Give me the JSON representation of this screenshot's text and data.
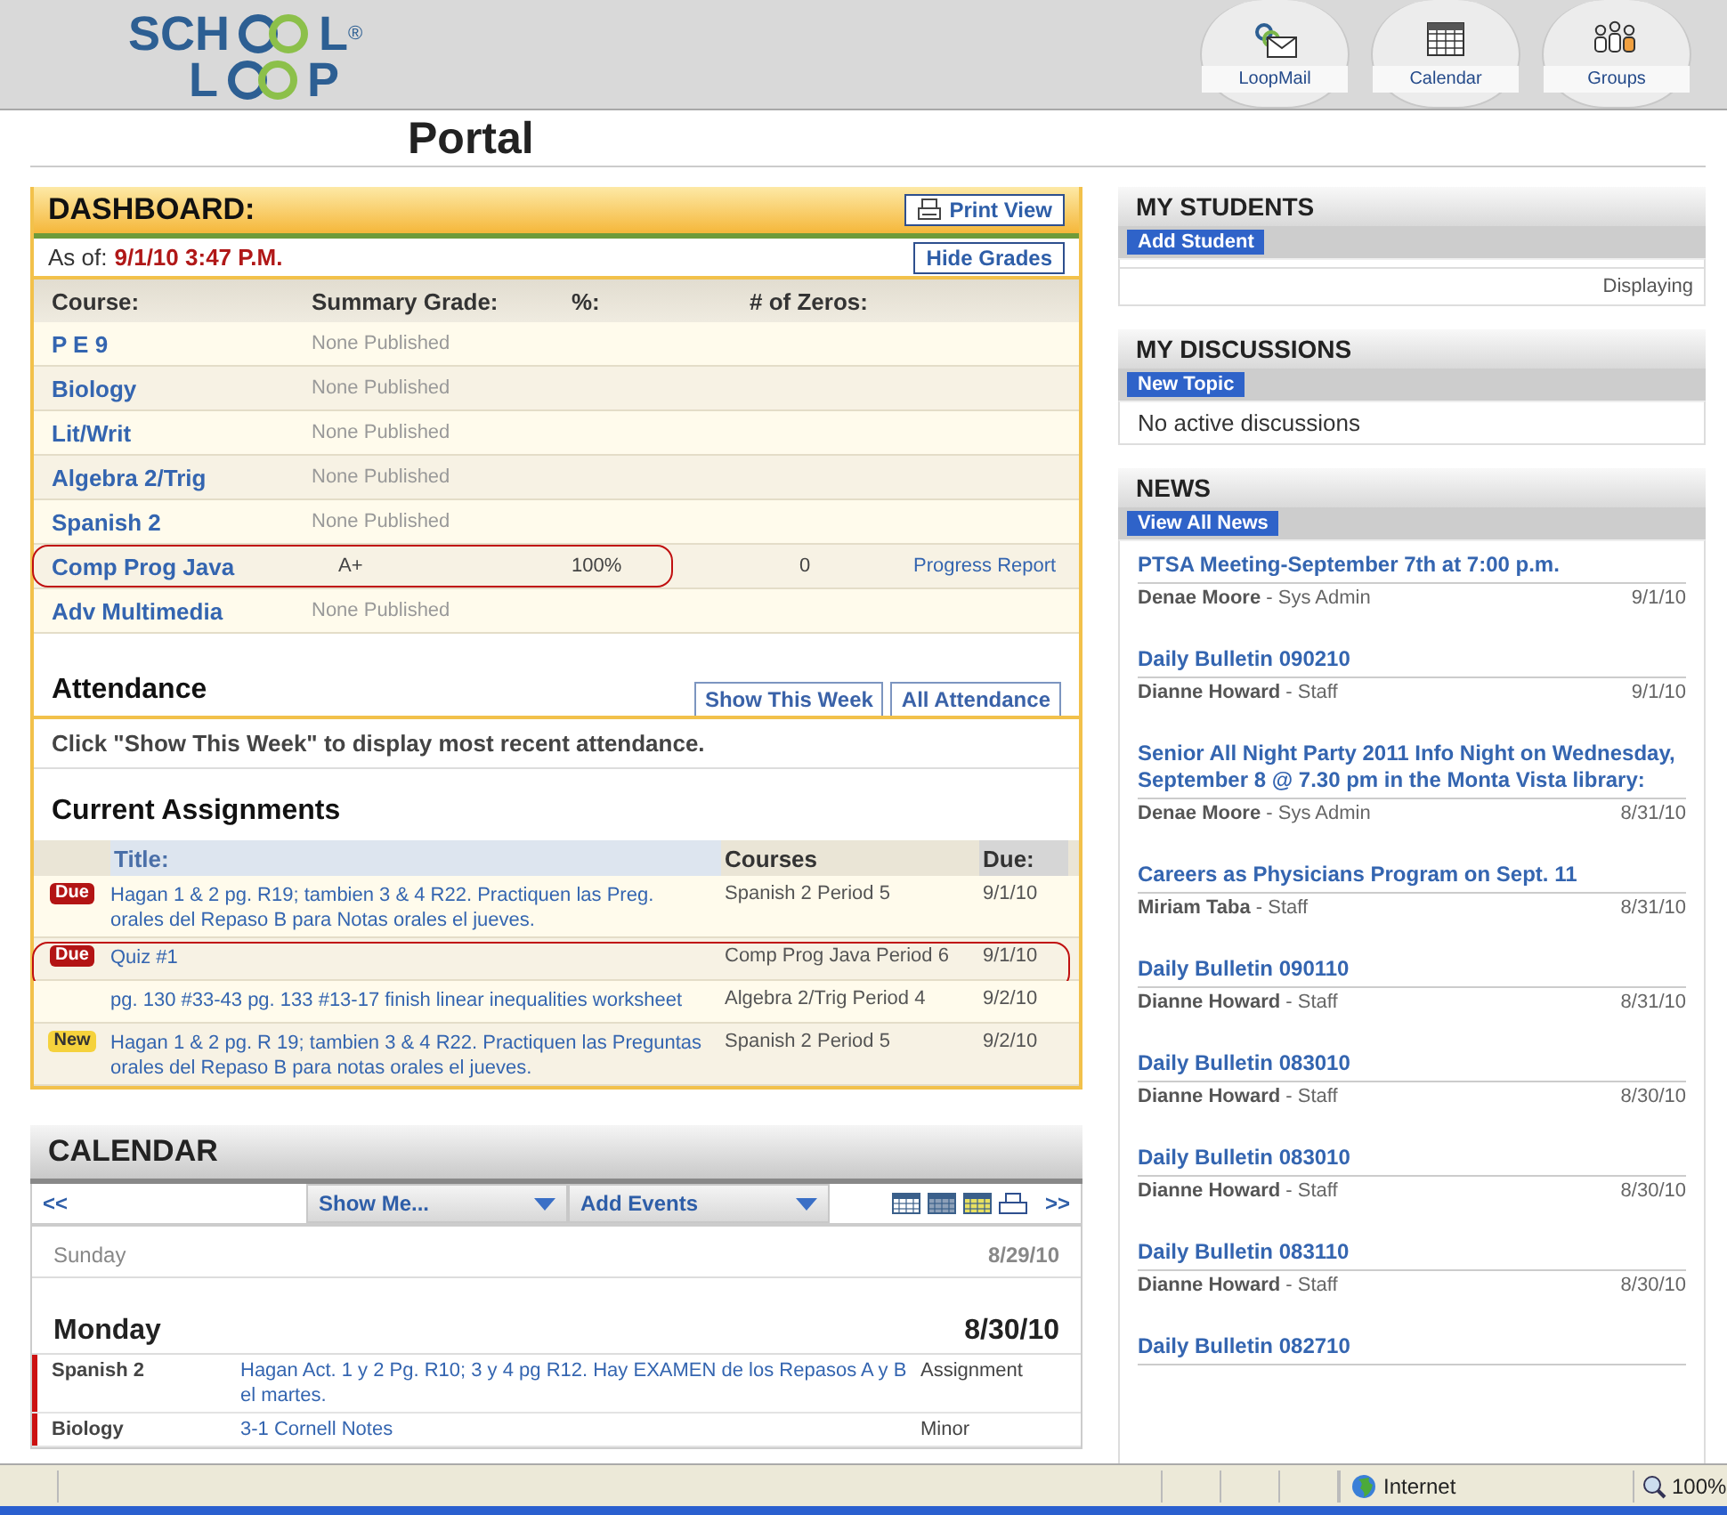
{
  "header": {
    "logo": {
      "line1_start": "SCH",
      "line1_end": "L",
      "line2_start": "L",
      "line2_end": "P",
      "mark": "®"
    },
    "nav": [
      {
        "kind": "mail",
        "label": "LoopMail"
      },
      {
        "kind": "calendar",
        "label": "Calendar"
      },
      {
        "kind": "groups",
        "label": "Groups"
      }
    ]
  },
  "page_title": "Portal",
  "dashboard": {
    "title": "DASHBOARD:",
    "print_button": "Print View",
    "as_of_label": "As of:",
    "as_of_value": "9/1/10 3:47 P.M.",
    "hide_button": "Hide Grades",
    "columns": [
      "Course:",
      "Summary Grade:",
      "%:",
      "# of Zeros:"
    ],
    "courses": [
      {
        "name": "P E 9",
        "published": false,
        "summary": "None Published",
        "circled": false
      },
      {
        "name": "Biology",
        "published": false,
        "summary": "None Published",
        "circled": false
      },
      {
        "name": "Lit/Writ",
        "published": false,
        "summary": "None Published",
        "circled": false
      },
      {
        "name": "Algebra 2/Trig",
        "published": false,
        "summary": "None Published",
        "circled": false
      },
      {
        "name": "Spanish 2",
        "published": false,
        "summary": "None Published",
        "circled": false
      },
      {
        "name": "Comp Prog Java",
        "published": true,
        "summary": "A+",
        "percent": "100%",
        "zeros": "0",
        "report": "Progress Report",
        "circled": true
      },
      {
        "name": "Adv Multimedia",
        "published": false,
        "summary": "None Published",
        "circled": false
      }
    ],
    "attendance": {
      "title": "Attendance",
      "buttons": [
        "Show This Week",
        "All Attendance"
      ],
      "message": "Click \"Show This Week\" to display most recent attendance."
    },
    "assignments": {
      "title": "Current Assignments",
      "columns": [
        "Title:",
        "Courses",
        "Due:"
      ],
      "rows": [
        {
          "kind": "due",
          "badge": "Due",
          "title": "Hagan 1 & 2 pg. R19; tambien 3 & 4 R22. Practiquen las Preg. orales del Repaso B para Notas orales el jueves.",
          "course": "Spanish 2 Period 5",
          "due": "9/1/10",
          "circled": false
        },
        {
          "kind": "due",
          "badge": "Due",
          "title": "Quiz #1",
          "course": "Comp Prog Java Period 6",
          "due": "9/1/10",
          "circled": true
        },
        {
          "kind": "none",
          "title": "pg. 130 #33-43 pg. 133 #13-17 finish linear inequalities worksheet",
          "course": "Algebra 2/Trig Period 4",
          "due": "9/2/10",
          "circled": false
        },
        {
          "kind": "new",
          "badge": "New",
          "title": "Hagan 1 & 2 pg. R 19; tambien 3 & 4 R22. Practiquen las Preguntas orales del Repaso B para notas orales el jueves.",
          "course": "Spanish 2 Period 5",
          "due": "9/2/10",
          "circled": false
        }
      ]
    }
  },
  "calendar": {
    "title": "CALENDAR",
    "prev": "<<",
    "next": ">>",
    "dropdowns": [
      "Show Me...",
      "Add Events"
    ],
    "days": [
      {
        "name": "Sunday",
        "date": "8/29/10",
        "current": false
      },
      {
        "name": "Monday",
        "date": "8/30/10",
        "current": true,
        "events": [
          {
            "course": "Spanish 2",
            "title": "Hagan Act. 1 y 2 Pg. R10; 3 y 4 pg R12. Hay EXAMEN de los Repasos A y B el martes.",
            "type": "Assignment",
            "color": "#cc1111"
          },
          {
            "course": "Biology",
            "title": "3-1 Cornell Notes",
            "type": "Minor",
            "color": "#cc1111"
          }
        ]
      }
    ]
  },
  "my_students": {
    "title": "MY STUDENTS",
    "button": "Add Student",
    "status": "Displaying"
  },
  "my_discussions": {
    "title": "MY DISCUSSIONS",
    "button": "New Topic",
    "message": "No active discussions"
  },
  "news": {
    "title": "NEWS",
    "button": "View All News",
    "items": [
      {
        "title": "PTSA Meeting-September 7th at 7:00 p.m.",
        "byline": "**Denae Moore** - Sys Admin",
        "date": "9/1/10"
      },
      {
        "title": "Daily Bulletin 090210",
        "byline": "**Dianne Howard** - Staff",
        "date": "9/1/10"
      },
      {
        "title": "Senior All Night Party 2011 Info Night on Wednesday, September 8 @ 7.30 pm in the Monta Vista library:",
        "byline": "**Denae Moore** - Sys Admin",
        "date": "8/31/10"
      },
      {
        "title": "Careers as Physicians Program on Sept. 11",
        "byline": "**Miriam Taba** - Staff",
        "date": "8/31/10"
      },
      {
        "title": "Daily Bulletin 090110",
        "byline": "**Dianne Howard** - Staff",
        "date": "8/31/10"
      },
      {
        "title": "Daily Bulletin 083010",
        "byline": "**Dianne Howard** - Staff",
        "date": "8/30/10"
      },
      {
        "title": "Daily Bulletin 083010",
        "byline": "**Dianne Howard** - Staff",
        "date": "8/30/10"
      },
      {
        "title": "Daily Bulletin 083110",
        "byline": "**Dianne Howard** - Staff",
        "date": "8/30/10"
      },
      {
        "title": "Daily Bulletin 082710"
      }
    ]
  },
  "status_bar": {
    "zone": "Internet",
    "zoom": "100%"
  }
}
